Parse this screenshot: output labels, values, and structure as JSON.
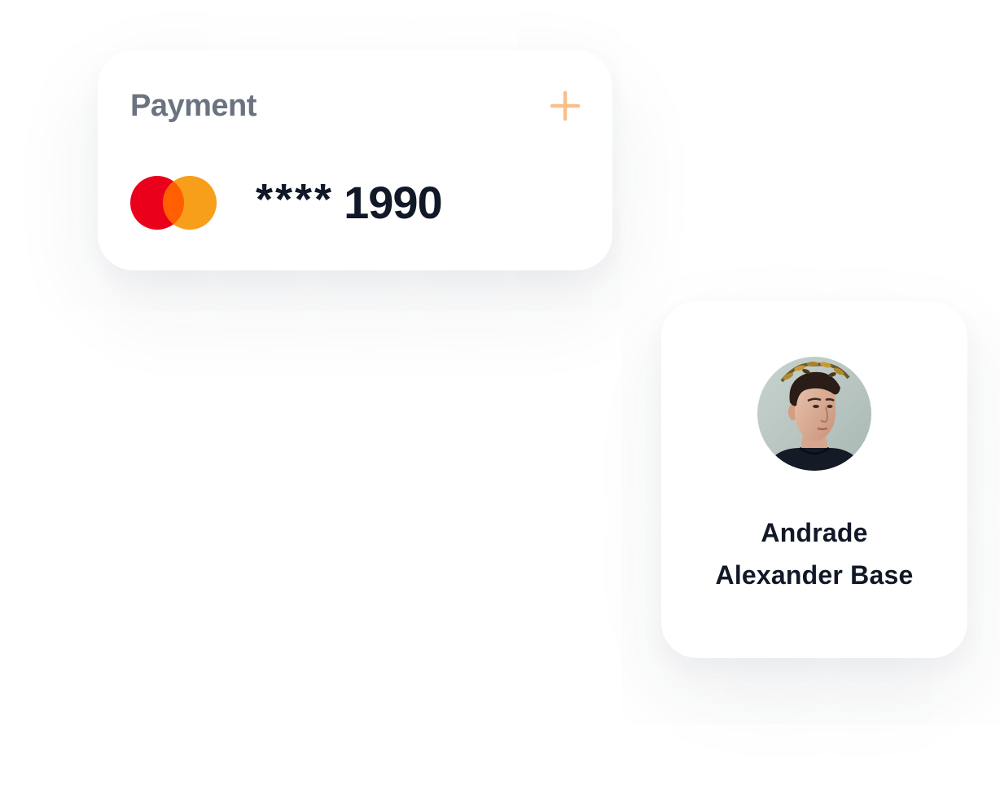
{
  "payment": {
    "title": "Payment",
    "add_icon": "plus-icon",
    "card_brand_icon": "mastercard-logo-icon",
    "card_mask": "****",
    "card_last4": "1990",
    "colors": {
      "title": "#6b7280",
      "accent": "#fbbf8a",
      "brand_red": "#eb001b",
      "brand_orange": "#f79e1b",
      "brand_overlap": "#ff5f00"
    }
  },
  "profile": {
    "avatar_icon": "user-avatar",
    "name_line1": "Andrade",
    "name_line2": "Alexander Base"
  }
}
